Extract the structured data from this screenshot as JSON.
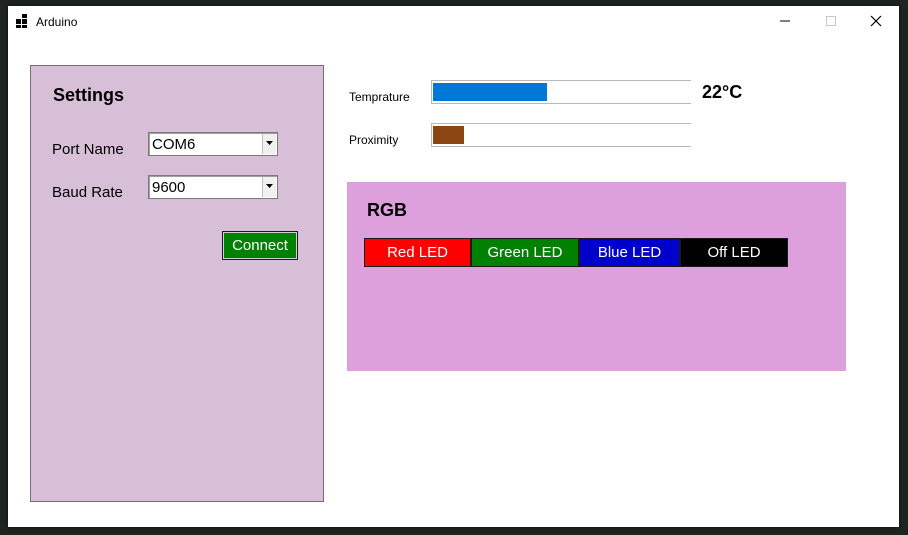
{
  "window": {
    "title": "Arduino",
    "icons": {
      "app": "app-windows-icon",
      "minimize": "minimize-icon",
      "maximize": "maximize-icon",
      "close": "close-icon"
    }
  },
  "settings": {
    "title": "Settings",
    "port_label": "Port Name",
    "port_value": "COM6",
    "baud_label": "Baud Rate",
    "baud_value": "9600",
    "connect_label": "Connect",
    "panel_color": "#d8bfd8",
    "connect_color": "#008000"
  },
  "sensors": {
    "temperature_label": "Temprature",
    "temperature_value": "22°C",
    "temperature_progress": 0.44,
    "temperature_color": "#0078d7",
    "proximity_label": "Proximity",
    "proximity_progress": 0.12,
    "proximity_color": "#8b4513"
  },
  "rgb": {
    "title": "RGB",
    "panel_color": "#dda0dd",
    "buttons": [
      {
        "label": "Red LED",
        "color": "#ff0000"
      },
      {
        "label": "Green LED",
        "color": "#008000"
      },
      {
        "label": "Blue LED",
        "color": "#0000cd"
      },
      {
        "label": "Off LED",
        "color": "#000000"
      }
    ]
  }
}
